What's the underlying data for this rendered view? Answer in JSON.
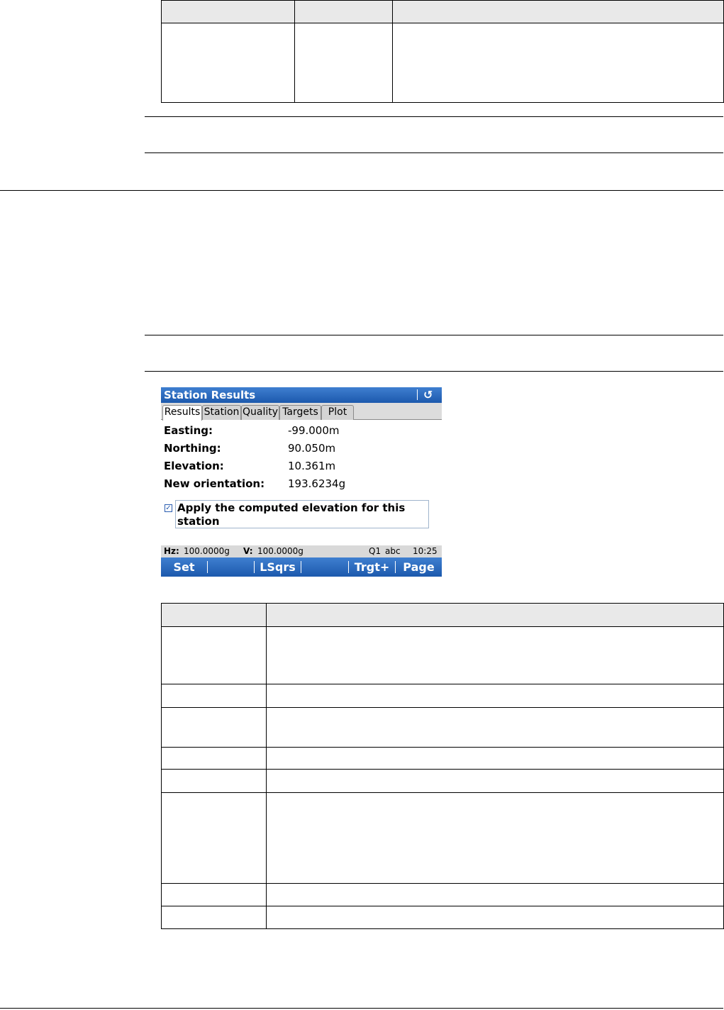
{
  "screen": {
    "title": "Station Results",
    "tabs": [
      "Results",
      "Station",
      "Quality",
      "Targets",
      "Plot"
    ],
    "fields": [
      {
        "label": "Easting:",
        "value": "-99.000m"
      },
      {
        "label": "Northing:",
        "value": "90.050m"
      },
      {
        "label": "Elevation:",
        "value": "10.361m"
      },
      {
        "label": "New orientation:",
        "value": "193.6234g"
      }
    ],
    "checkbox": {
      "checked": true,
      "label": "Apply the computed elevation for this station"
    },
    "status": {
      "hz_label": "Hz:",
      "hz_value": "100.0000g",
      "v_label": "V:",
      "v_value": "100.0000g",
      "quality": "Q1",
      "input_mode": "abc",
      "time": "10:25"
    },
    "softkeys": [
      "Set",
      "",
      "LSqrs",
      "",
      "Trgt+",
      "Page"
    ]
  }
}
